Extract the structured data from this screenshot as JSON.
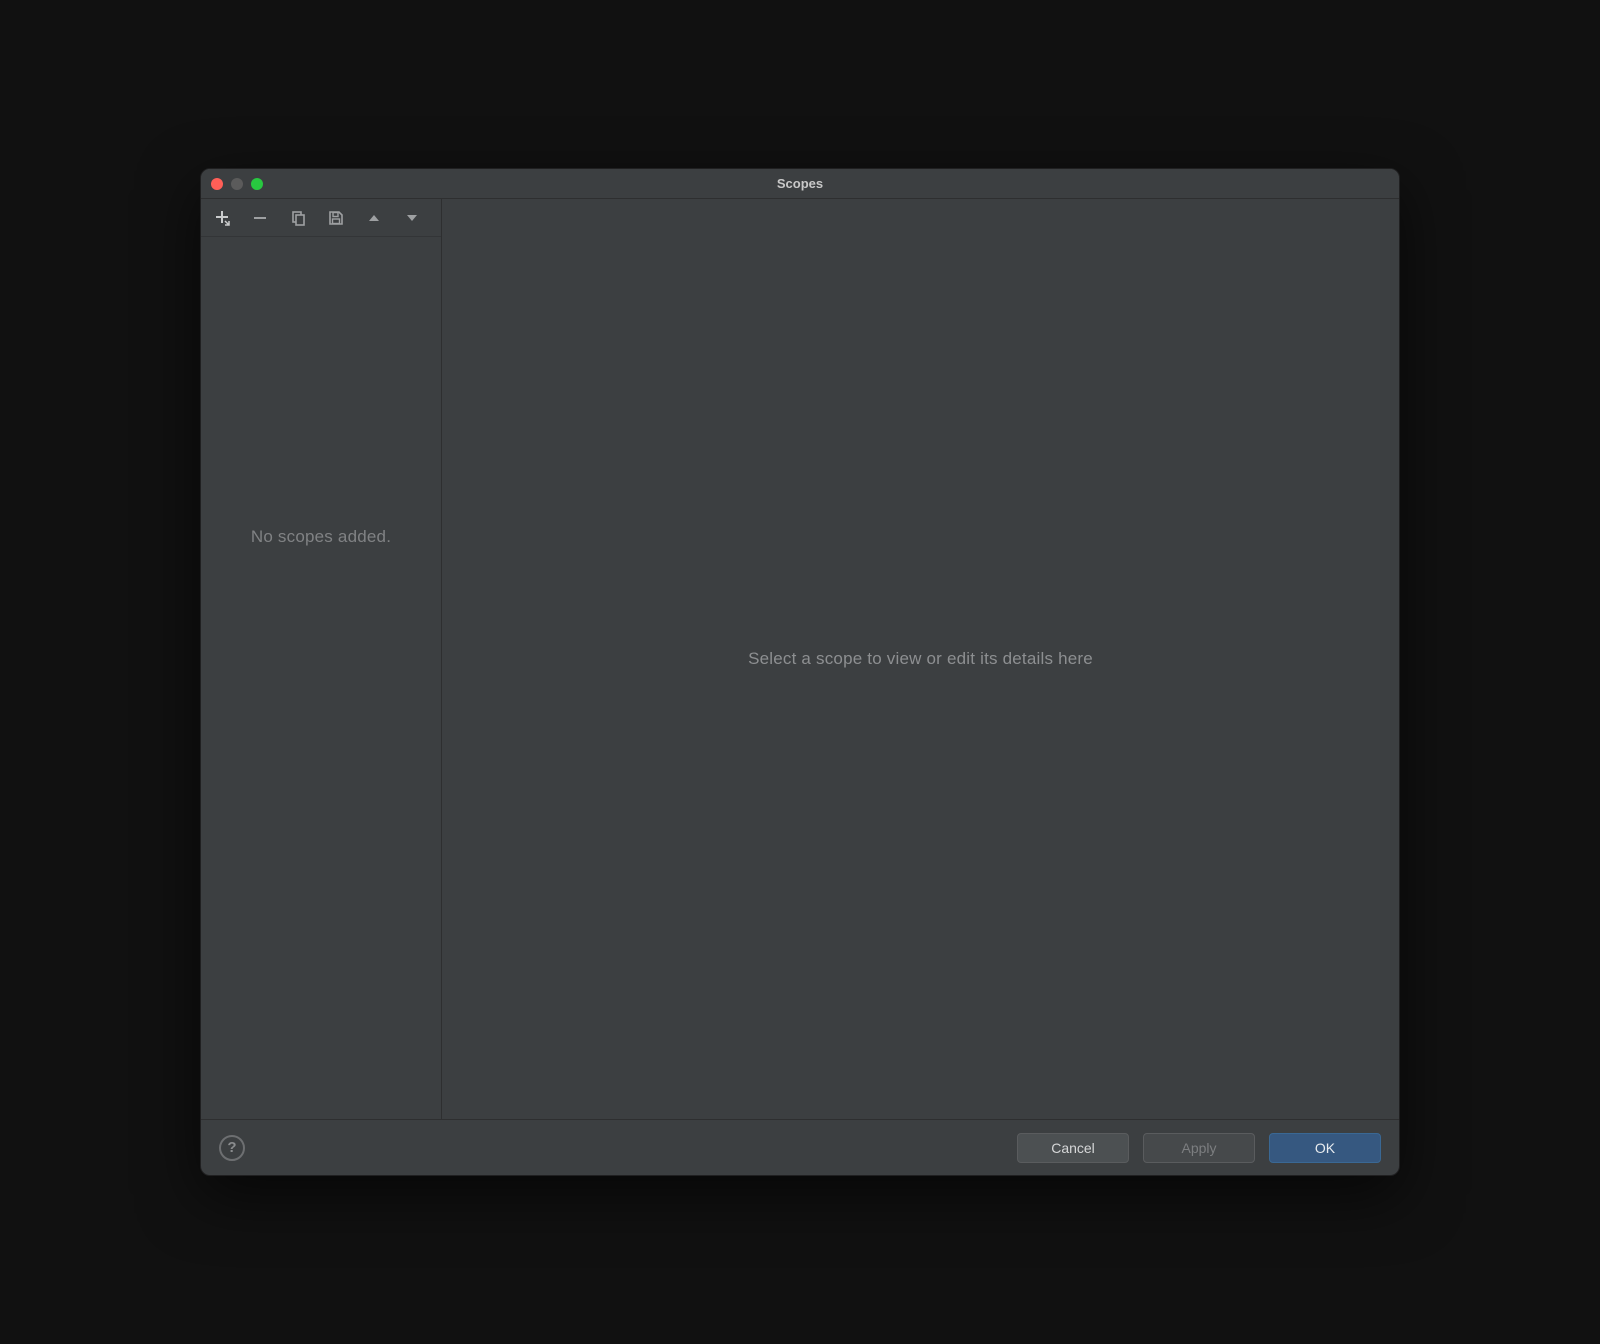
{
  "window": {
    "title": "Scopes"
  },
  "sidebar": {
    "empty_label": "No scopes added."
  },
  "main": {
    "hint": "Select a scope to view or edit its details here"
  },
  "footer": {
    "help": "?",
    "cancel": "Cancel",
    "apply": "Apply",
    "ok": "OK"
  },
  "icons": {
    "add": "add-icon",
    "remove": "remove-icon",
    "copy": "copy-icon",
    "save": "save-icon",
    "up": "move-up-icon",
    "down": "move-down-icon"
  }
}
